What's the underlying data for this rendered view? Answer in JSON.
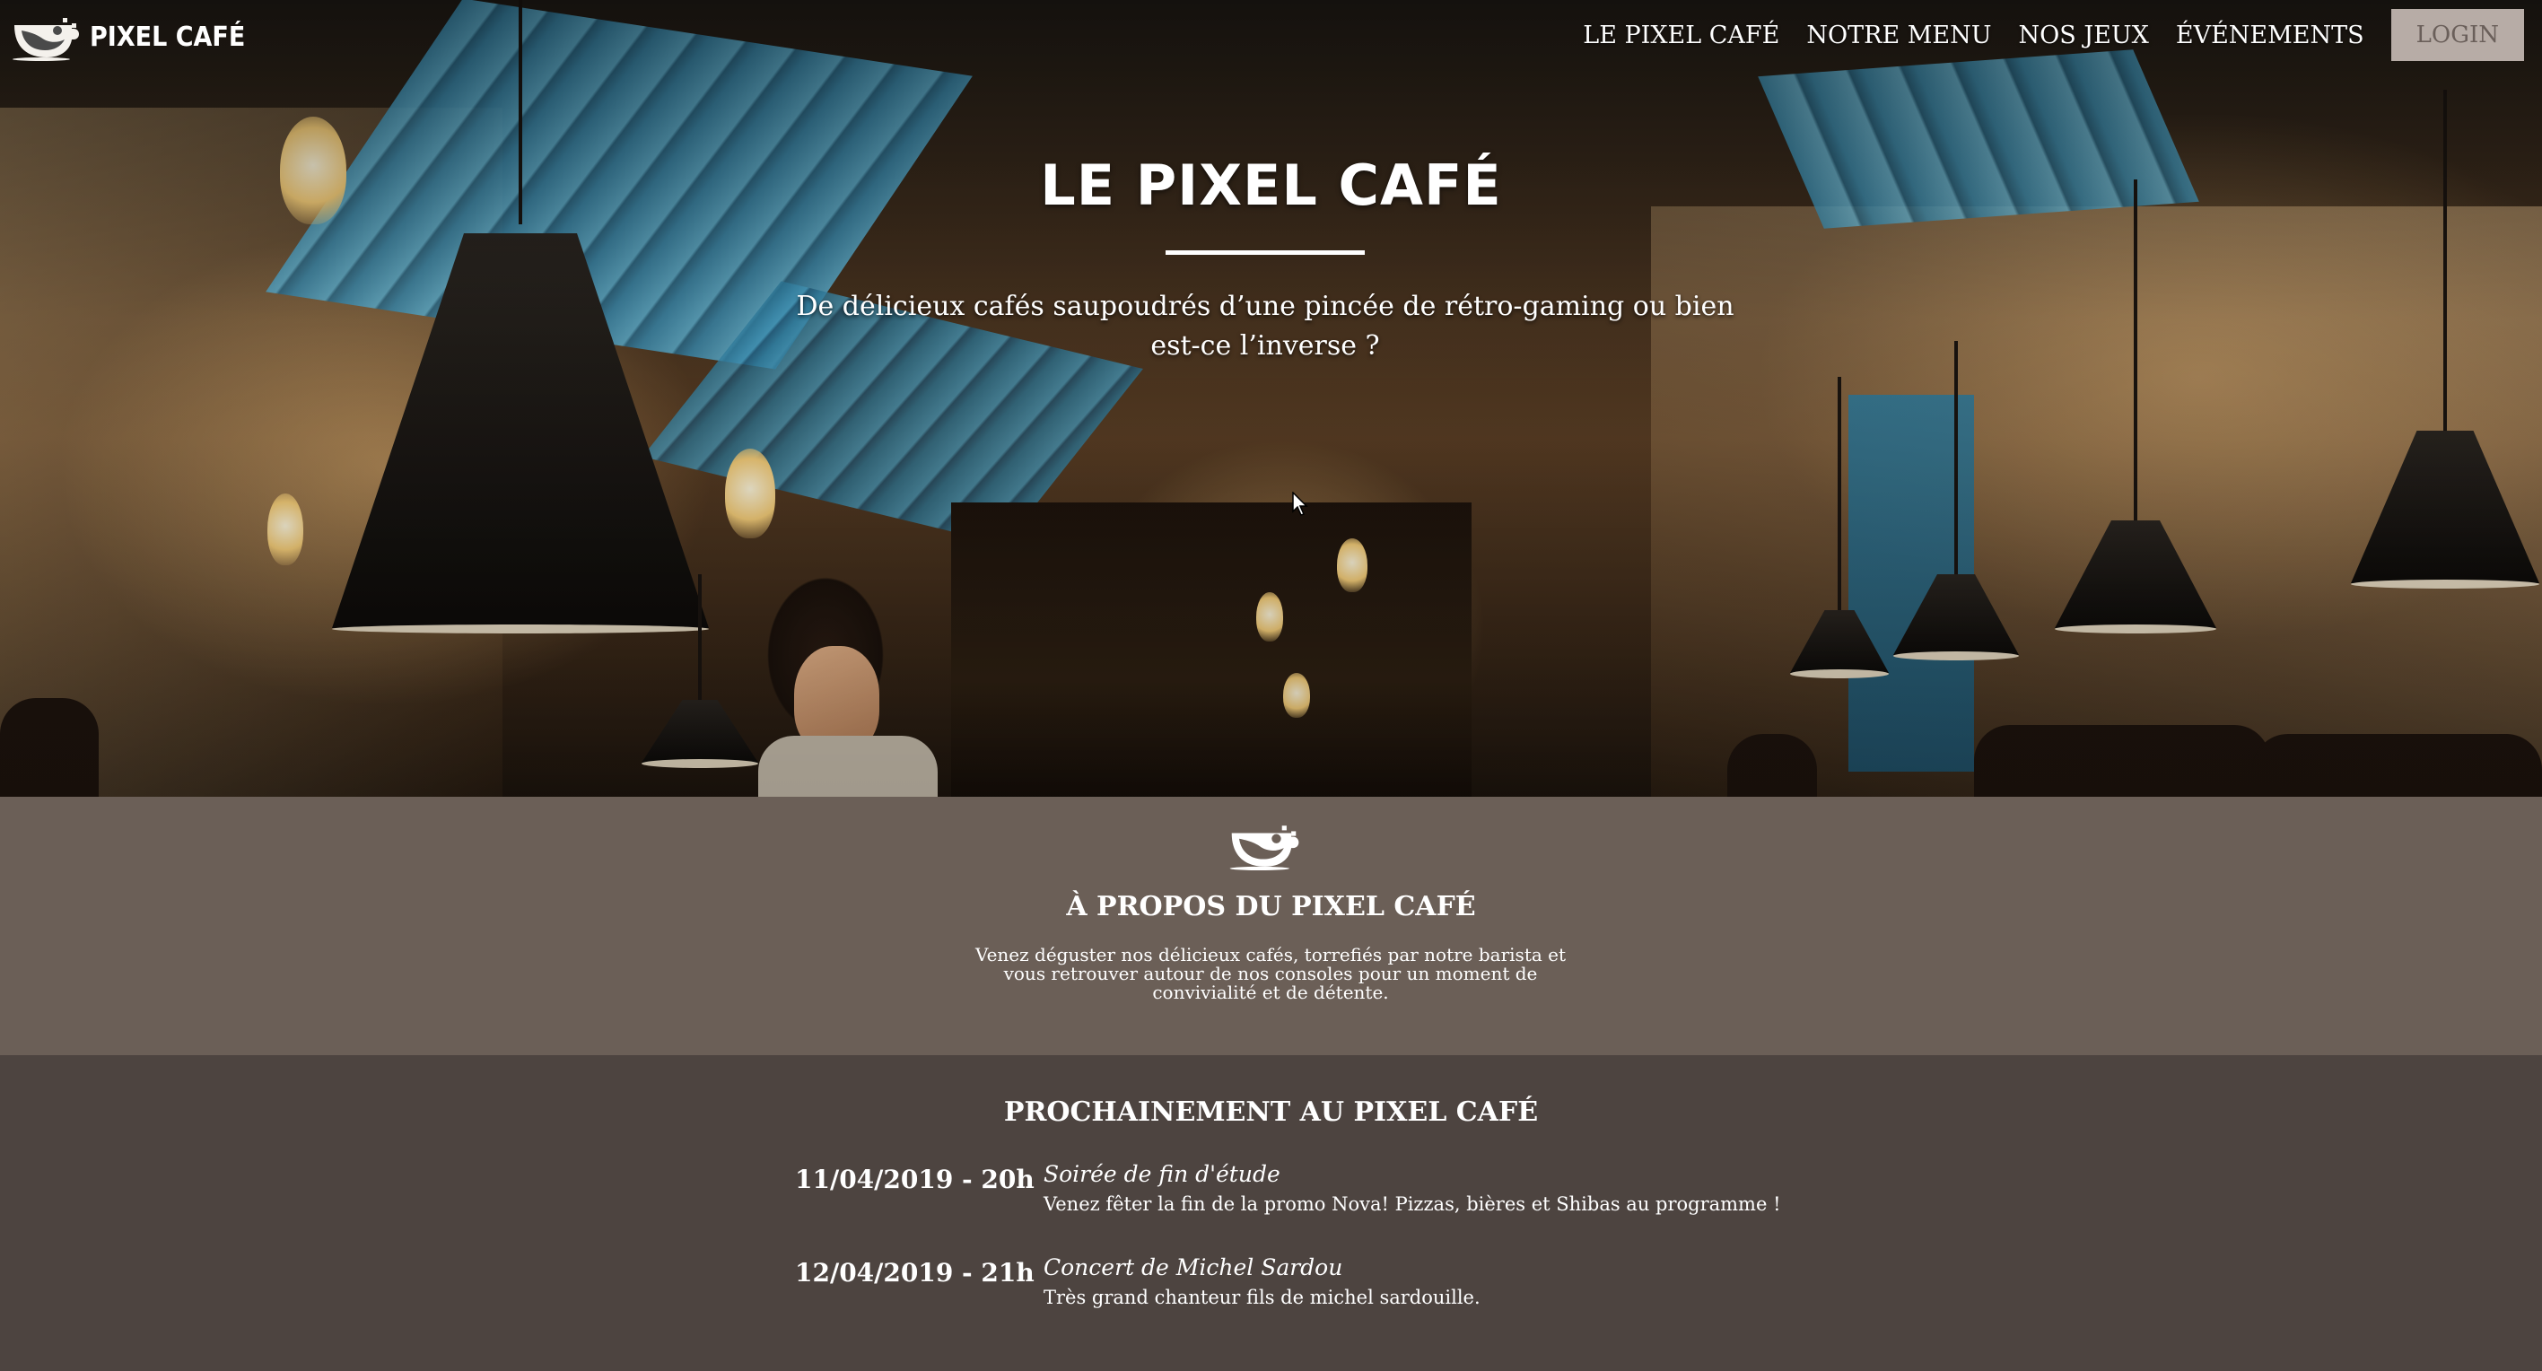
{
  "navbar": {
    "brand_name": "PIXEL CAFÉ",
    "links": [
      "LE PIXEL CAFÉ",
      "NOTRE MENU",
      "NOS JEUX",
      "ÉVÉNEMENTS"
    ],
    "login_label": "LOGIN"
  },
  "hero": {
    "title": "LE PIXEL CAFÉ",
    "subtitle": "De délicieux cafés saupoudrés d’une pincée de rétro-gaming ou bien est-ce l’inverse ?"
  },
  "about": {
    "title": "À PROPOS DU PIXEL CAFÉ",
    "text": "Venez déguster nos délicieux cafés, torrefiés par notre barista et vous retrouver autour de nos consoles pour un moment de convivialité et de détente."
  },
  "events": {
    "title": "PROCHAINEMENT AU PIXEL CAFÉ",
    "items": [
      {
        "date": "11/04/2019 - 20h",
        "name": "Soirée de fin d'étude",
        "description": "Venez fêter la fin de la promo Nova! Pizzas, bières et Shibas au programme !"
      },
      {
        "date": "12/04/2019 - 21h",
        "name": "Concert de Michel Sardou",
        "description": "Très grand chanteur fils de michel sardouille."
      }
    ]
  },
  "colors": {
    "about_bg": "#6b5f57",
    "events_bg": "#4d4440",
    "login_bg": "#b7aca6"
  },
  "icons": [
    "coffee-cup-logo-icon",
    "mouse-cursor-icon"
  ]
}
